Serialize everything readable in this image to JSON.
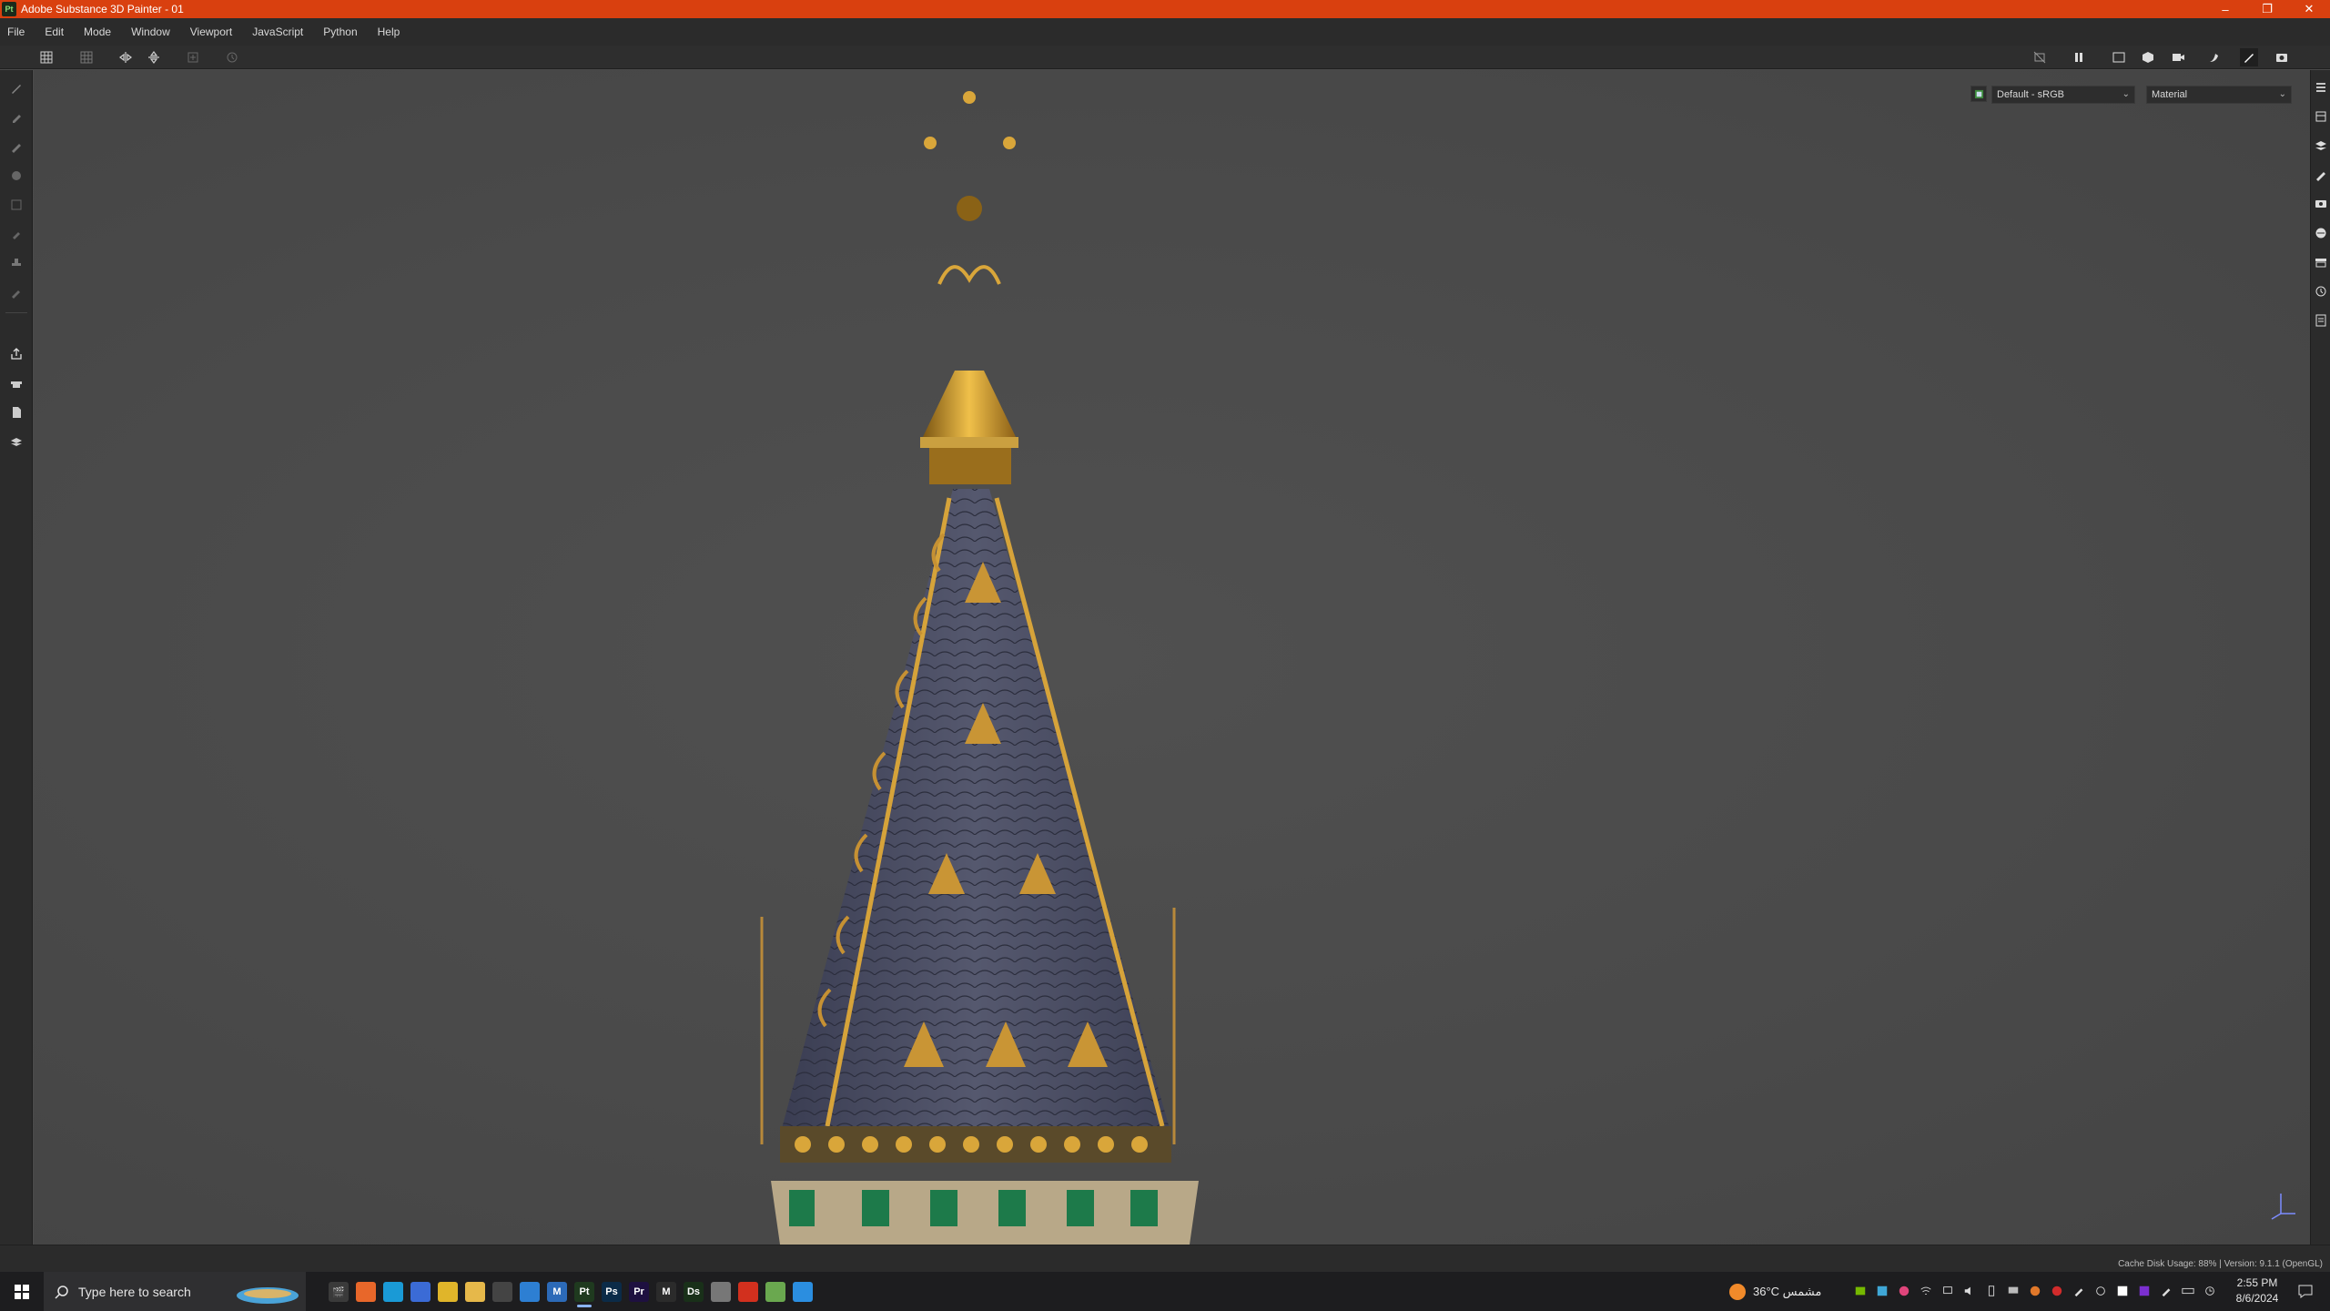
{
  "window": {
    "title": "Adobe Substance 3D Painter - 01",
    "logo_text": "Pt",
    "controls": {
      "minimize": "–",
      "maximize": "❐",
      "close": "✕"
    }
  },
  "menu": [
    "File",
    "Edit",
    "Mode",
    "Window",
    "Viewport",
    "JavaScript",
    "Python",
    "Help"
  ],
  "viewport": {
    "color_profile": "Default - sRGB",
    "display_mode": "Material",
    "chevron": "⌄"
  },
  "status": {
    "text": "Cache Disk Usage:   88% | Version: 9.1.1 (OpenGL)"
  },
  "taskbar": {
    "search_placeholder": "Type here to search",
    "apps": [
      {
        "name": "clapperboard",
        "letter": "🎬",
        "color": "#3a3a3a"
      },
      {
        "name": "firefox",
        "letter": "",
        "color": "#e8672a"
      },
      {
        "name": "edge",
        "letter": "",
        "color": "#1a9ad6"
      },
      {
        "name": "store",
        "letter": "",
        "color": "#3b6bd6"
      },
      {
        "name": "chrome",
        "letter": "",
        "color": "#e0b52a"
      },
      {
        "name": "file-explorer",
        "letter": "",
        "color": "#e6b84a"
      },
      {
        "name": "search-app",
        "letter": "",
        "color": "#444"
      },
      {
        "name": "blue-app",
        "letter": "",
        "color": "#2d7fd3"
      },
      {
        "name": "m-app",
        "letter": "M",
        "color": "#2c6ab8"
      },
      {
        "name": "substance-painter",
        "letter": "Pt",
        "color": "#1f3a1f"
      },
      {
        "name": "photoshop",
        "letter": "Ps",
        "color": "#0b2b48"
      },
      {
        "name": "premiere",
        "letter": "Pr",
        "color": "#1e1040"
      },
      {
        "name": "m-yellow",
        "letter": "M",
        "color": "#2b2b2b"
      },
      {
        "name": "substance-designer",
        "letter": "Ds",
        "color": "#193019"
      },
      {
        "name": "image-app",
        "letter": "",
        "color": "#777"
      },
      {
        "name": "red-app",
        "letter": "",
        "color": "#d2301e"
      },
      {
        "name": "green-app",
        "letter": "",
        "color": "#6aa84f"
      },
      {
        "name": "circle-app",
        "letter": "",
        "color": "#2b8ee0"
      }
    ],
    "weather": "36°C  مشمس",
    "time": "2:55 PM",
    "date": "8/6/2024"
  }
}
